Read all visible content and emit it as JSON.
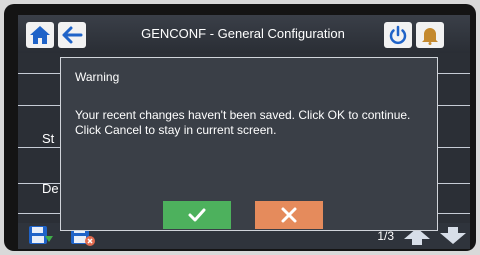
{
  "header": {
    "title": "GENCONF - General Configuration",
    "icons": [
      "home-icon",
      "back-arrow-icon",
      "power-icon",
      "bell-icon"
    ]
  },
  "background": {
    "row_labels": [
      "St",
      "De"
    ]
  },
  "dialog": {
    "title": "Warning",
    "message": "Your recent changes haven't been saved. Click OK to continue. Click Cancel to stay in current screen.",
    "ok_icon": "checkmark-icon",
    "cancel_icon": "x-icon"
  },
  "footer": {
    "page_indicator": "1/3",
    "icons": [
      "save-icon",
      "discard-save-icon",
      "page-up-icon",
      "page-down-icon"
    ]
  },
  "colors": {
    "ok": "#4db15d",
    "cancel": "#e58b5c",
    "icon_blue": "#1f63c8"
  }
}
